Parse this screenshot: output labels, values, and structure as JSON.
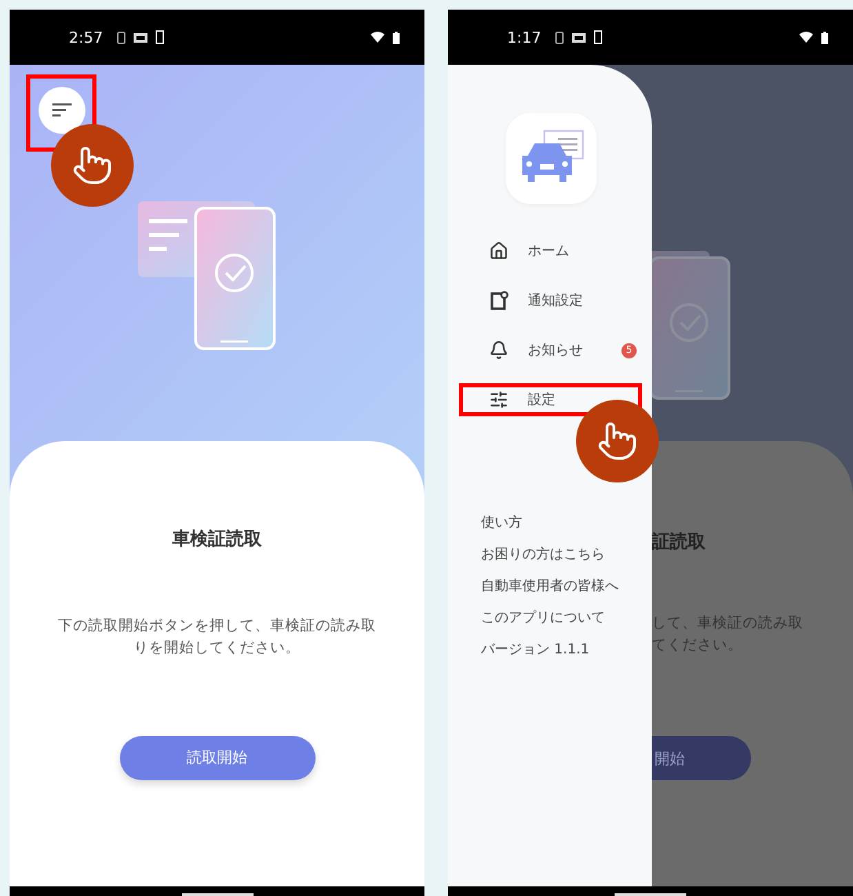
{
  "screens": [
    {
      "kind": "home",
      "status_time": "2:57",
      "menu_button": {
        "highlighted": true
      },
      "title": "車検証読取",
      "description": "下の読取開始ボタンを押して、車検証の読み取りを開始してください。",
      "start_button": "読取開始"
    },
    {
      "kind": "drawer",
      "status_time": "1:17",
      "menu": [
        {
          "kind": "home",
          "label": "ホーム",
          "highlighted": false
        },
        {
          "kind": "notification_settings",
          "label": "通知設定",
          "highlighted": false
        },
        {
          "kind": "news",
          "label": "お知らせ",
          "badge": "5",
          "highlighted": false
        },
        {
          "kind": "settings",
          "label": "設定",
          "highlighted": true
        }
      ],
      "links": [
        "使い方",
        "お困りの方はこちら",
        "自動車使用者の皆様へ",
        "このアプリについて",
        "バージョン 1.1.1"
      ],
      "background": {
        "title_fragment": "証読取",
        "description_lines": [
          "して、車検証の読み取",
          "てください。"
        ],
        "button_fragment": "開始"
      }
    }
  ]
}
